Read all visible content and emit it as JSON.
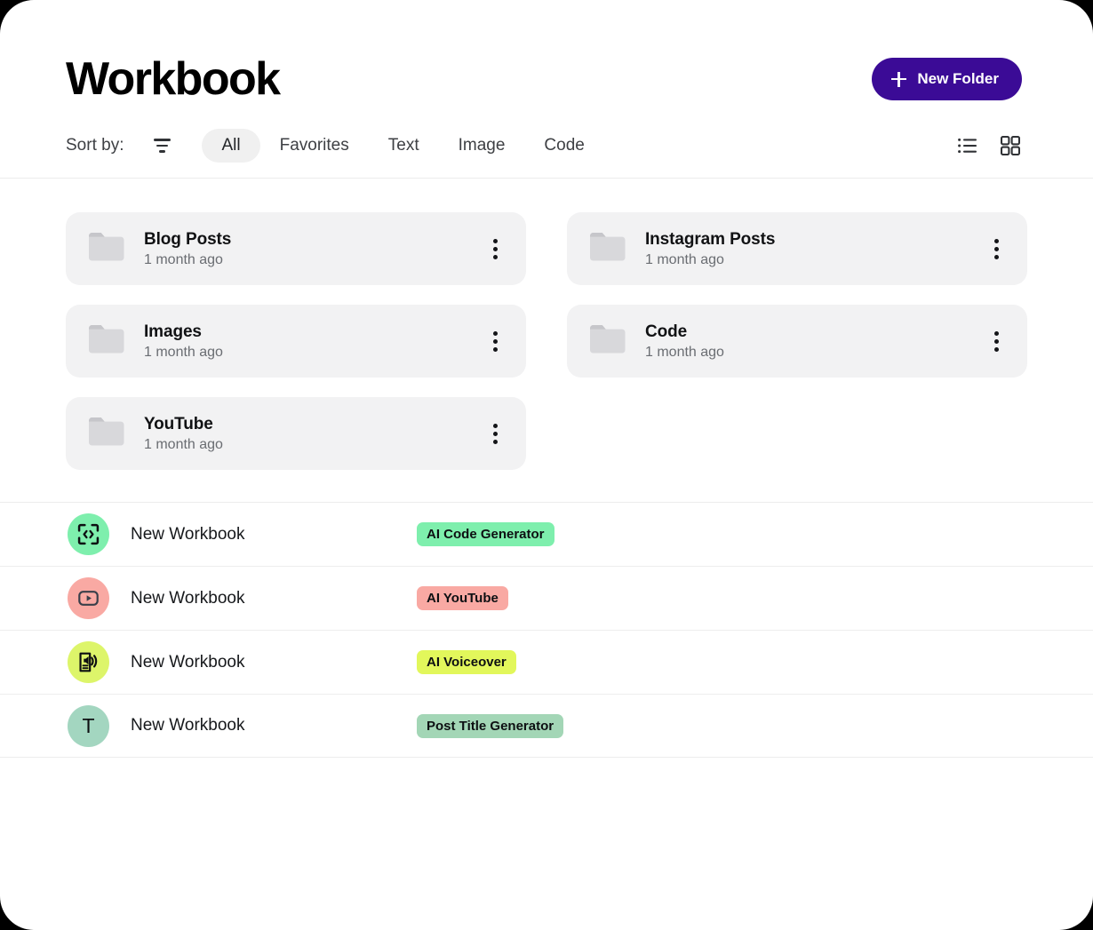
{
  "header": {
    "title": "Workbook",
    "new_folder_label": "New Folder",
    "new_folder_icon": "plus-icon",
    "accent_color": "#3B0B96"
  },
  "toolbar": {
    "sort_label": "Sort by:",
    "filter_icon": "filter-icon",
    "tabs": [
      {
        "label": "All",
        "active": true
      },
      {
        "label": "Favorites",
        "active": false
      },
      {
        "label": "Text",
        "active": false
      },
      {
        "label": "Image",
        "active": false
      },
      {
        "label": "Code",
        "active": false
      }
    ],
    "views": [
      {
        "icon": "list-view-icon",
        "active": false
      },
      {
        "icon": "grid-view-icon",
        "active": true
      }
    ]
  },
  "folders": [
    {
      "name": "Blog Posts",
      "date": "1 month ago",
      "icon": "folder-icon",
      "menu_icon": "kebab-menu-icon"
    },
    {
      "name": "Instagram Posts",
      "date": "1 month ago",
      "icon": "folder-icon",
      "menu_icon": "kebab-menu-icon"
    },
    {
      "name": "Images",
      "date": "1 month ago",
      "icon": "folder-icon",
      "menu_icon": "kebab-menu-icon"
    },
    {
      "name": "Code",
      "date": "1 month ago",
      "icon": "folder-icon",
      "menu_icon": "kebab-menu-icon"
    },
    {
      "name": "YouTube",
      "date": "1 month ago",
      "icon": "folder-icon",
      "menu_icon": "kebab-menu-icon"
    }
  ],
  "workbooks": [
    {
      "name": "New Workbook",
      "tag": "AI Code Generator",
      "tag_color": "#7EEFAD",
      "avatar_color": "#7EEFAD",
      "avatar_icon": "code-brackets-icon",
      "avatar_letter": ""
    },
    {
      "name": "New Workbook",
      "tag": "AI YouTube",
      "tag_color": "#F9A9A3",
      "avatar_color": "#F9A9A3",
      "avatar_icon": "youtube-play-icon",
      "avatar_letter": ""
    },
    {
      "name": "New Workbook",
      "tag": "AI Voiceover",
      "tag_color": "#E2F75B",
      "avatar_color": "#DDF56A",
      "avatar_icon": "voiceover-speaker-icon",
      "avatar_letter": ""
    },
    {
      "name": "New Workbook",
      "tag": "Post Title Generator",
      "tag_color": "#A3D6B6",
      "avatar_color": "#A3D6C0",
      "avatar_icon": "letter-avatar",
      "avatar_letter": "T"
    }
  ]
}
